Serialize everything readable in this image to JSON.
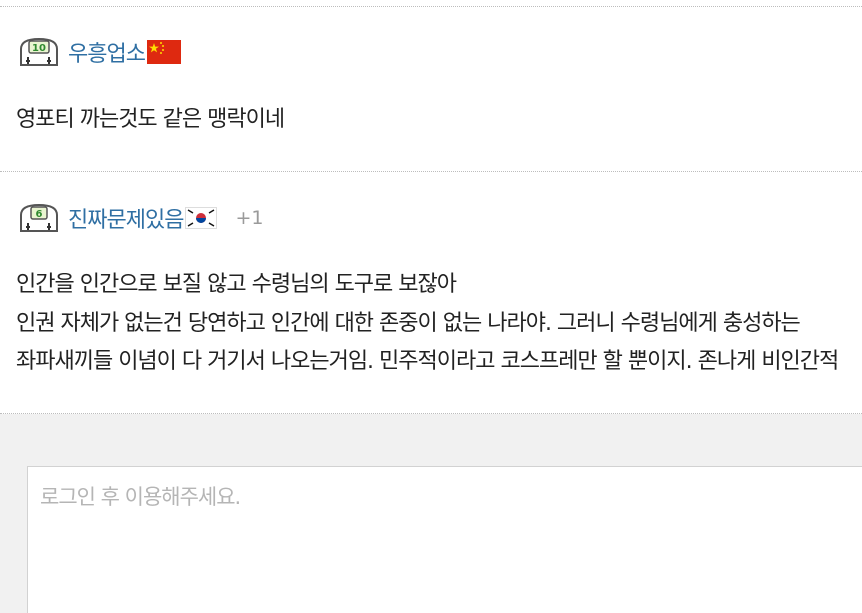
{
  "comments": [
    {
      "level": "10",
      "nickname": "우흥업소",
      "flag_icon": "china-flag-icon",
      "vote": "",
      "lines": [
        "영포티 까는것도 같은 맹락이네"
      ]
    },
    {
      "level": "6",
      "nickname": "진짜문제있음",
      "flag_icon": "korea-flag-icon",
      "vote": "+1",
      "lines": [
        "인간을 인간으로 보질 않고 수령님의 도구로 보잖아",
        "인권 자체가 없는건 당연하고 인간에 대한 존중이 없는 나라야. 그러니 수령님에게 충성하는",
        "좌파새끼들 이념이 다 거기서 나오는거임. 민주적이라고 코스프레만 할 뿐이지. 존나게 비인간적"
      ]
    }
  ],
  "comment_input": {
    "placeholder": "로그인 후 이용해주세요."
  },
  "colors": {
    "nickname": "#2f6fa3",
    "vote": "#9a9a9a",
    "divider": "#bdbdbd",
    "input_area_bg": "#f1f1f1",
    "placeholder": "#b5b5b5"
  }
}
